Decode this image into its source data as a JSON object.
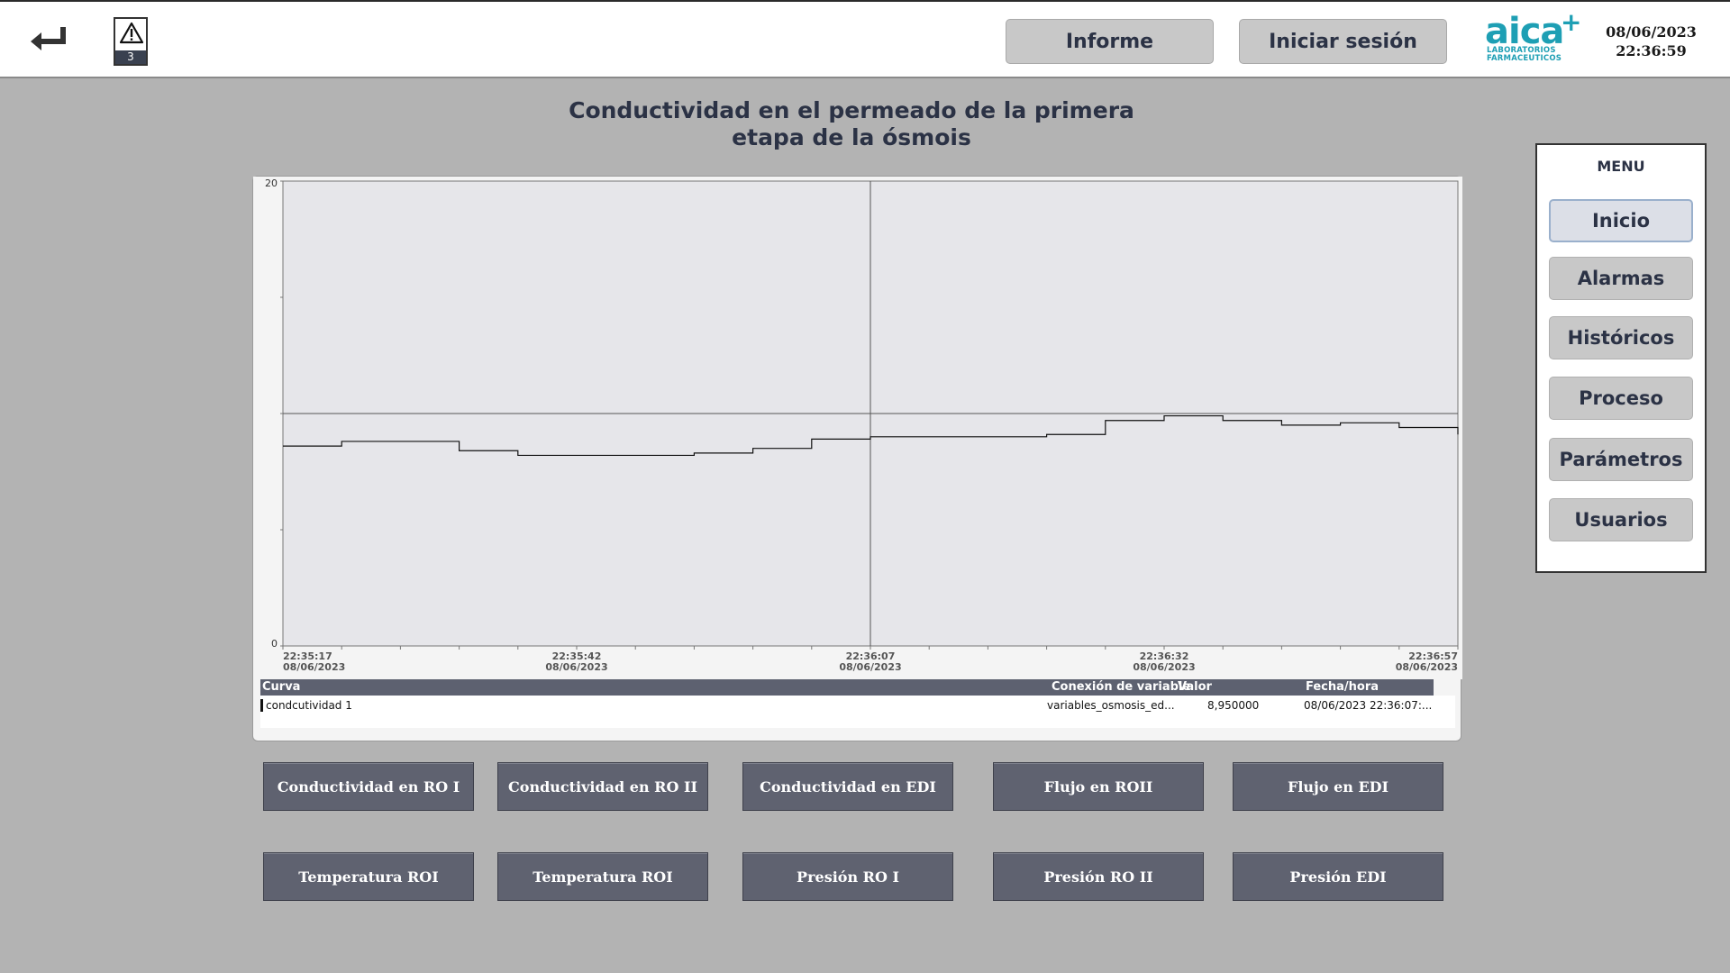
{
  "header": {
    "alarm_count": "3",
    "report_label": "Informe",
    "login_label": "Iniciar sesión",
    "logo_text": "aica",
    "logo_plus": "+",
    "logo_sub_1": "LABORATORIOS",
    "logo_sub_2": "FARMACEUTICOS",
    "date": "08/06/2023",
    "time": "22:36:59"
  },
  "title_line1": "Conductividad en el permeado de la primera",
  "title_line2": "etapa de la ósmois",
  "chart_data": {
    "type": "line",
    "ylim": [
      0,
      20
    ],
    "y_ticks": [
      "20",
      "0"
    ],
    "x_ticks": [
      {
        "time": "22:35:17",
        "date": "08/06/2023"
      },
      {
        "time": "22:35:42",
        "date": "08/06/2023"
      },
      {
        "time": "22:36:07",
        "date": "08/06/2023"
      },
      {
        "time": "22:36:32",
        "date": "08/06/2023"
      },
      {
        "time": "22:36:57",
        "date": "08/06/2023"
      }
    ],
    "x_range_seconds": [
      0,
      100
    ],
    "series": [
      {
        "name": "condcutividad 1",
        "x": [
          0,
          5,
          15,
          20,
          35,
          40,
          45,
          50,
          55,
          60,
          65,
          70,
          75,
          80,
          85,
          90,
          95,
          100
        ],
        "values": [
          8.6,
          8.8,
          8.4,
          8.2,
          8.3,
          8.5,
          8.9,
          9.0,
          9.0,
          9.0,
          9.1,
          9.7,
          9.9,
          9.7,
          9.5,
          9.6,
          9.4,
          9.1
        ],
        "color": "#111111"
      }
    ],
    "reference_line": {
      "y": 10.0
    }
  },
  "table": {
    "col_curve": "Curva",
    "col_connection": "Conexión de variable",
    "col_value": "Valor",
    "col_datetime": "Fecha/hora",
    "row": {
      "curve": "condcutividad 1",
      "connection": "variables_osmosis_ed...",
      "value": "8,950000",
      "datetime": "08/06/2023 22:36:07:..."
    }
  },
  "menu": {
    "title": "MENU",
    "items": [
      "Inicio",
      "Alarmas",
      "Históricos",
      "Proceso",
      "Parámetros",
      "Usuarios"
    ],
    "active": "Inicio"
  },
  "nav_buttons": {
    "row1": [
      "Conductividad en RO I",
      "Conductividad en RO II",
      "Conductividad en EDI",
      "Flujo en ROII",
      "Flujo en EDI"
    ],
    "row2": [
      "Temperatura ROI",
      "Temperatura ROI",
      "Presión RO I",
      "Presión RO II",
      "Presión EDI"
    ]
  },
  "colors": {
    "background": "#b3b3b3",
    "button_dark": "#5f6270",
    "accent": "#1e9fb4"
  }
}
